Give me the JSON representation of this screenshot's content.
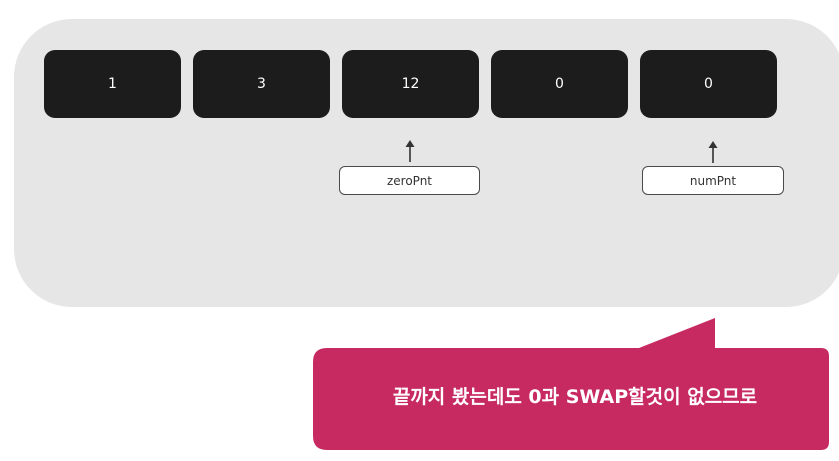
{
  "array": {
    "values": [
      "1",
      "3",
      "12",
      "0",
      "0"
    ]
  },
  "pointers": {
    "zero": "zeroPnt",
    "num": "numPnt"
  },
  "callout": {
    "text": "끝까지 봤는데도 0과 SWAP할것이 없으므로"
  },
  "colors": {
    "panel": "#e6e6e6",
    "cell": "#1c1c1c",
    "callout": "#c72a61"
  }
}
